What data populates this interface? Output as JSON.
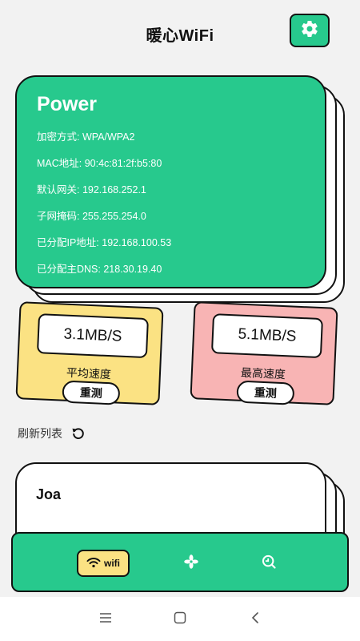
{
  "header": {
    "title": "暖心WiFi"
  },
  "network": {
    "name": "Power",
    "rows": [
      "加密方式: WPA/WPA2",
      "MAC地址: 90:4c:81:2f:b5:80",
      "默认网关: 192.168.252.1",
      "子网掩码: 255.255.254.0",
      "已分配IP地址: 192.168.100.53",
      "已分配主DNS: 218.30.19.40"
    ]
  },
  "speed": {
    "average": {
      "value": "3.1MB/S",
      "label": "平均速度",
      "button": "重测"
    },
    "max": {
      "value": "5.1MB/S",
      "label": "最高速度",
      "button": "重测"
    }
  },
  "list": {
    "refresh_label": "刷新列表",
    "items": [
      {
        "name": "Joa"
      }
    ]
  },
  "bottom_nav": {
    "wifi_label": "wifi"
  },
  "icons": {
    "settings": "gear-icon",
    "refresh": "refresh-icon",
    "wifi": "wifi-icon",
    "fan": "fan-icon",
    "speed_test": "search-speed-icon"
  },
  "colors": {
    "accent": "#27c98d",
    "yellow": "#fbe283",
    "pink": "#f8b4b4"
  }
}
